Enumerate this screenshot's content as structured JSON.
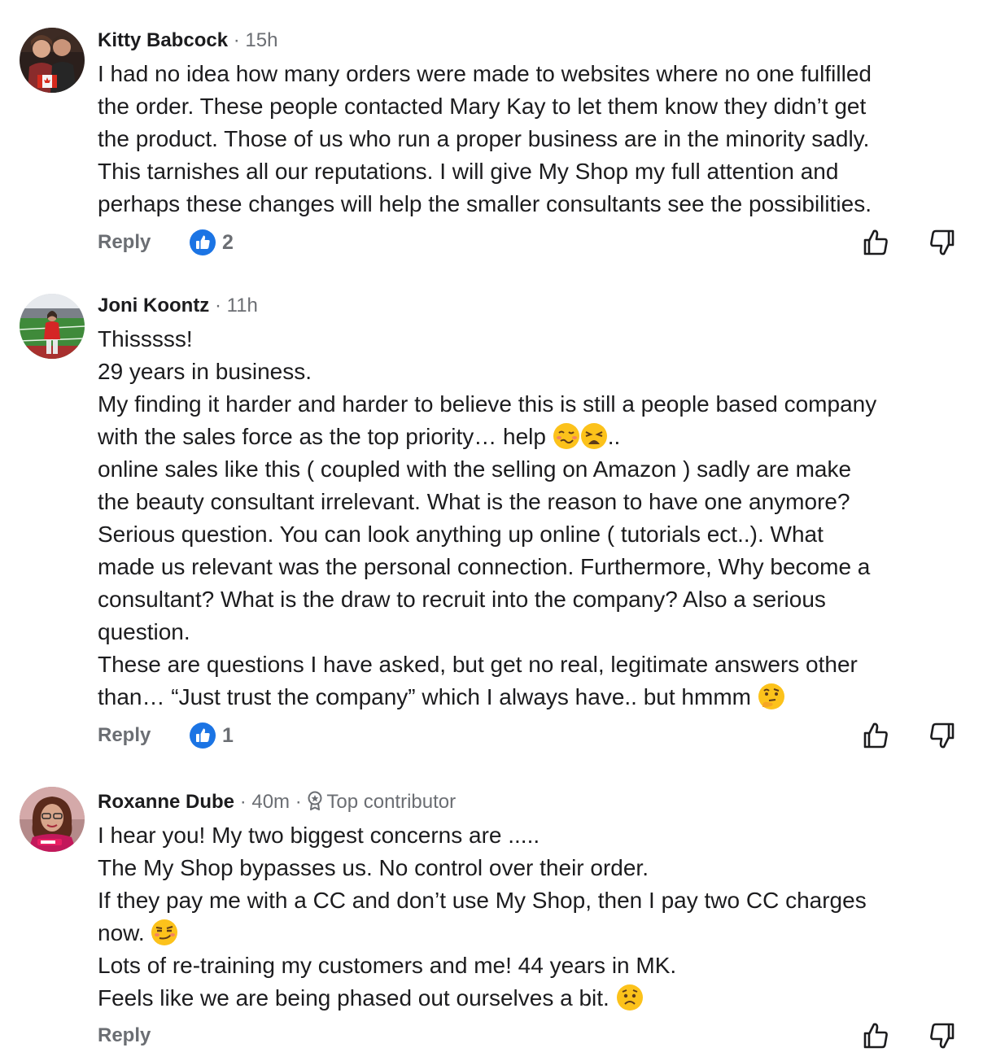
{
  "comments": [
    {
      "author": "Kitty Babcock",
      "time": "15h",
      "lines": [
        "I had no idea how many orders were made to websites where no one fulfilled",
        "the order.  These people contacted Mary Kay to let them know they didn’t get",
        "the product.  Those of us who run a proper business are in the minority sadly.",
        "This tarnishes all our reputations.  I will give My Shop my full attention and",
        "perhaps these changes will help the smaller consultants see the possibilities."
      ],
      "reply_label": "Reply",
      "like_count": "2",
      "avatar_icon": "avatar-couple-photo",
      "like_icon": "thumbs-up-badge-icon"
    },
    {
      "author": "Joni Koontz",
      "time": "11h",
      "lines": [
        "Thisssss!",
        "29 years in business.",
        "My finding it harder and harder to believe this is still a people based company",
        "with the sales force as the top priority… help ",
        "online sales like this ( coupled with the selling on Amazon ) sadly are make",
        "the beauty consultant irrelevant. What is the reason to have one anymore?",
        "Serious question. You can look anything up online ( tutorials ect..).  What",
        "made us relevant was the personal connection. Furthermore, Why become a",
        "consultant? What is the draw to recruit into the company? Also a serious",
        "question.",
        "These are questions I have asked, but get no real, legitimate answers other",
        "than… “Just trust the company” which I always have.. but hmmm "
      ],
      "line4_suffix": "..",
      "reply_label": "Reply",
      "like_count": "1",
      "avatar_icon": "avatar-stadium-photo",
      "emojis": [
        "woozy-face",
        "weary-face",
        "thinking-face"
      ]
    },
    {
      "author": "Roxanne Dube",
      "time": "40m",
      "badge": "Top contributor",
      "badge_icon": "top-contributor-icon",
      "lines": [
        "I hear you!  My two biggest concerns are .....",
        "The My Shop bypasses us. No control over their order.",
        "If they pay me with a CC and don’t use My Shop, then I pay two CC charges",
        "now. ",
        "Lots of re-training my customers and me!  44 years in MK.",
        "Feels like we are being phased out ourselves a bit. "
      ],
      "reply_label": "Reply",
      "avatar_icon": "avatar-portrait-photo",
      "emojis": [
        "smirking-face",
        "worried-face"
      ]
    }
  ],
  "colors": {
    "text": "#1c1c1e",
    "meta": "#6b6e73",
    "like_blue": "#1b74e4"
  }
}
